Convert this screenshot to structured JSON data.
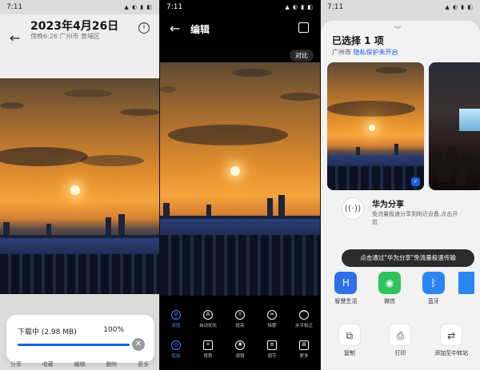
{
  "panel1": {
    "status_time": "7:11",
    "status_icons": "▲ ◐ ▮ ◧",
    "back_glyph": "←",
    "title": "2023年4月26日",
    "subtitle": "傍晚6:26  广州市 黄埔区",
    "info_glyph": "i",
    "download_label": "下载中 (2.98 MB)",
    "download_percent": "100%",
    "download_progress": 1.0,
    "cancel_glyph": "✕",
    "bottom_tabs": [
      "分享",
      "收藏",
      "编辑",
      "删除",
      "更多"
    ]
  },
  "panel2": {
    "status_time": "7:11",
    "status_icons": "▲ ◐ ▮ ◧",
    "back_glyph": "←",
    "title": "编辑",
    "compare_label": "对比",
    "filter_row": [
      {
        "label": "原图",
        "glyph": "⊘",
        "active": true
      },
      {
        "label": "自动优化",
        "glyph": "A",
        "active": false
      },
      {
        "label": "提亮",
        "glyph": "☼",
        "active": false
      },
      {
        "label": "除雾",
        "glyph": "≈",
        "active": false
      },
      {
        "label": "水平校正",
        "glyph": "⌒",
        "active": false
      }
    ],
    "tool_row": [
      {
        "label": "智能",
        "glyph": "◎",
        "active": true
      },
      {
        "label": "修剪",
        "glyph": "⌗",
        "active": false
      },
      {
        "label": "滤镜",
        "glyph": "❀",
        "active": false
      },
      {
        "label": "调节",
        "glyph": "≡",
        "active": false
      },
      {
        "label": "更多",
        "glyph": "⊞",
        "active": false
      }
    ]
  },
  "panel3": {
    "status_time": "7:11",
    "status_icons": "▲ ◐ ▮ ◧",
    "handle_glyph": "︾",
    "selected_title": "已选择 1 项",
    "location": "广州市",
    "privacy_link": "隐私保护未开启",
    "check_glyph": "✓",
    "huawei_share_icon": "((·))",
    "huawei_share_title": "华为分享",
    "huawei_share_desc": "免流量极速分享到附近设备,点击开启",
    "tooltip": "点击通过\"华为分享\"免流量极速传输",
    "share_apps": [
      {
        "label": "智慧生活",
        "glyph": "H",
        "color": "#2f6fe8"
      },
      {
        "label": "微信",
        "glyph": "◉",
        "color": "#2dc25b"
      },
      {
        "label": "蓝牙",
        "glyph": "ᛒ",
        "color": "#2b85f2"
      },
      {
        "label": "",
        "glyph": "",
        "color": "#2b85f2"
      }
    ],
    "actions": [
      {
        "label": "复制",
        "glyph": "⧉"
      },
      {
        "label": "打印",
        "glyph": "⎙"
      },
      {
        "label": "添加至中转站",
        "glyph": "⇄"
      }
    ]
  }
}
